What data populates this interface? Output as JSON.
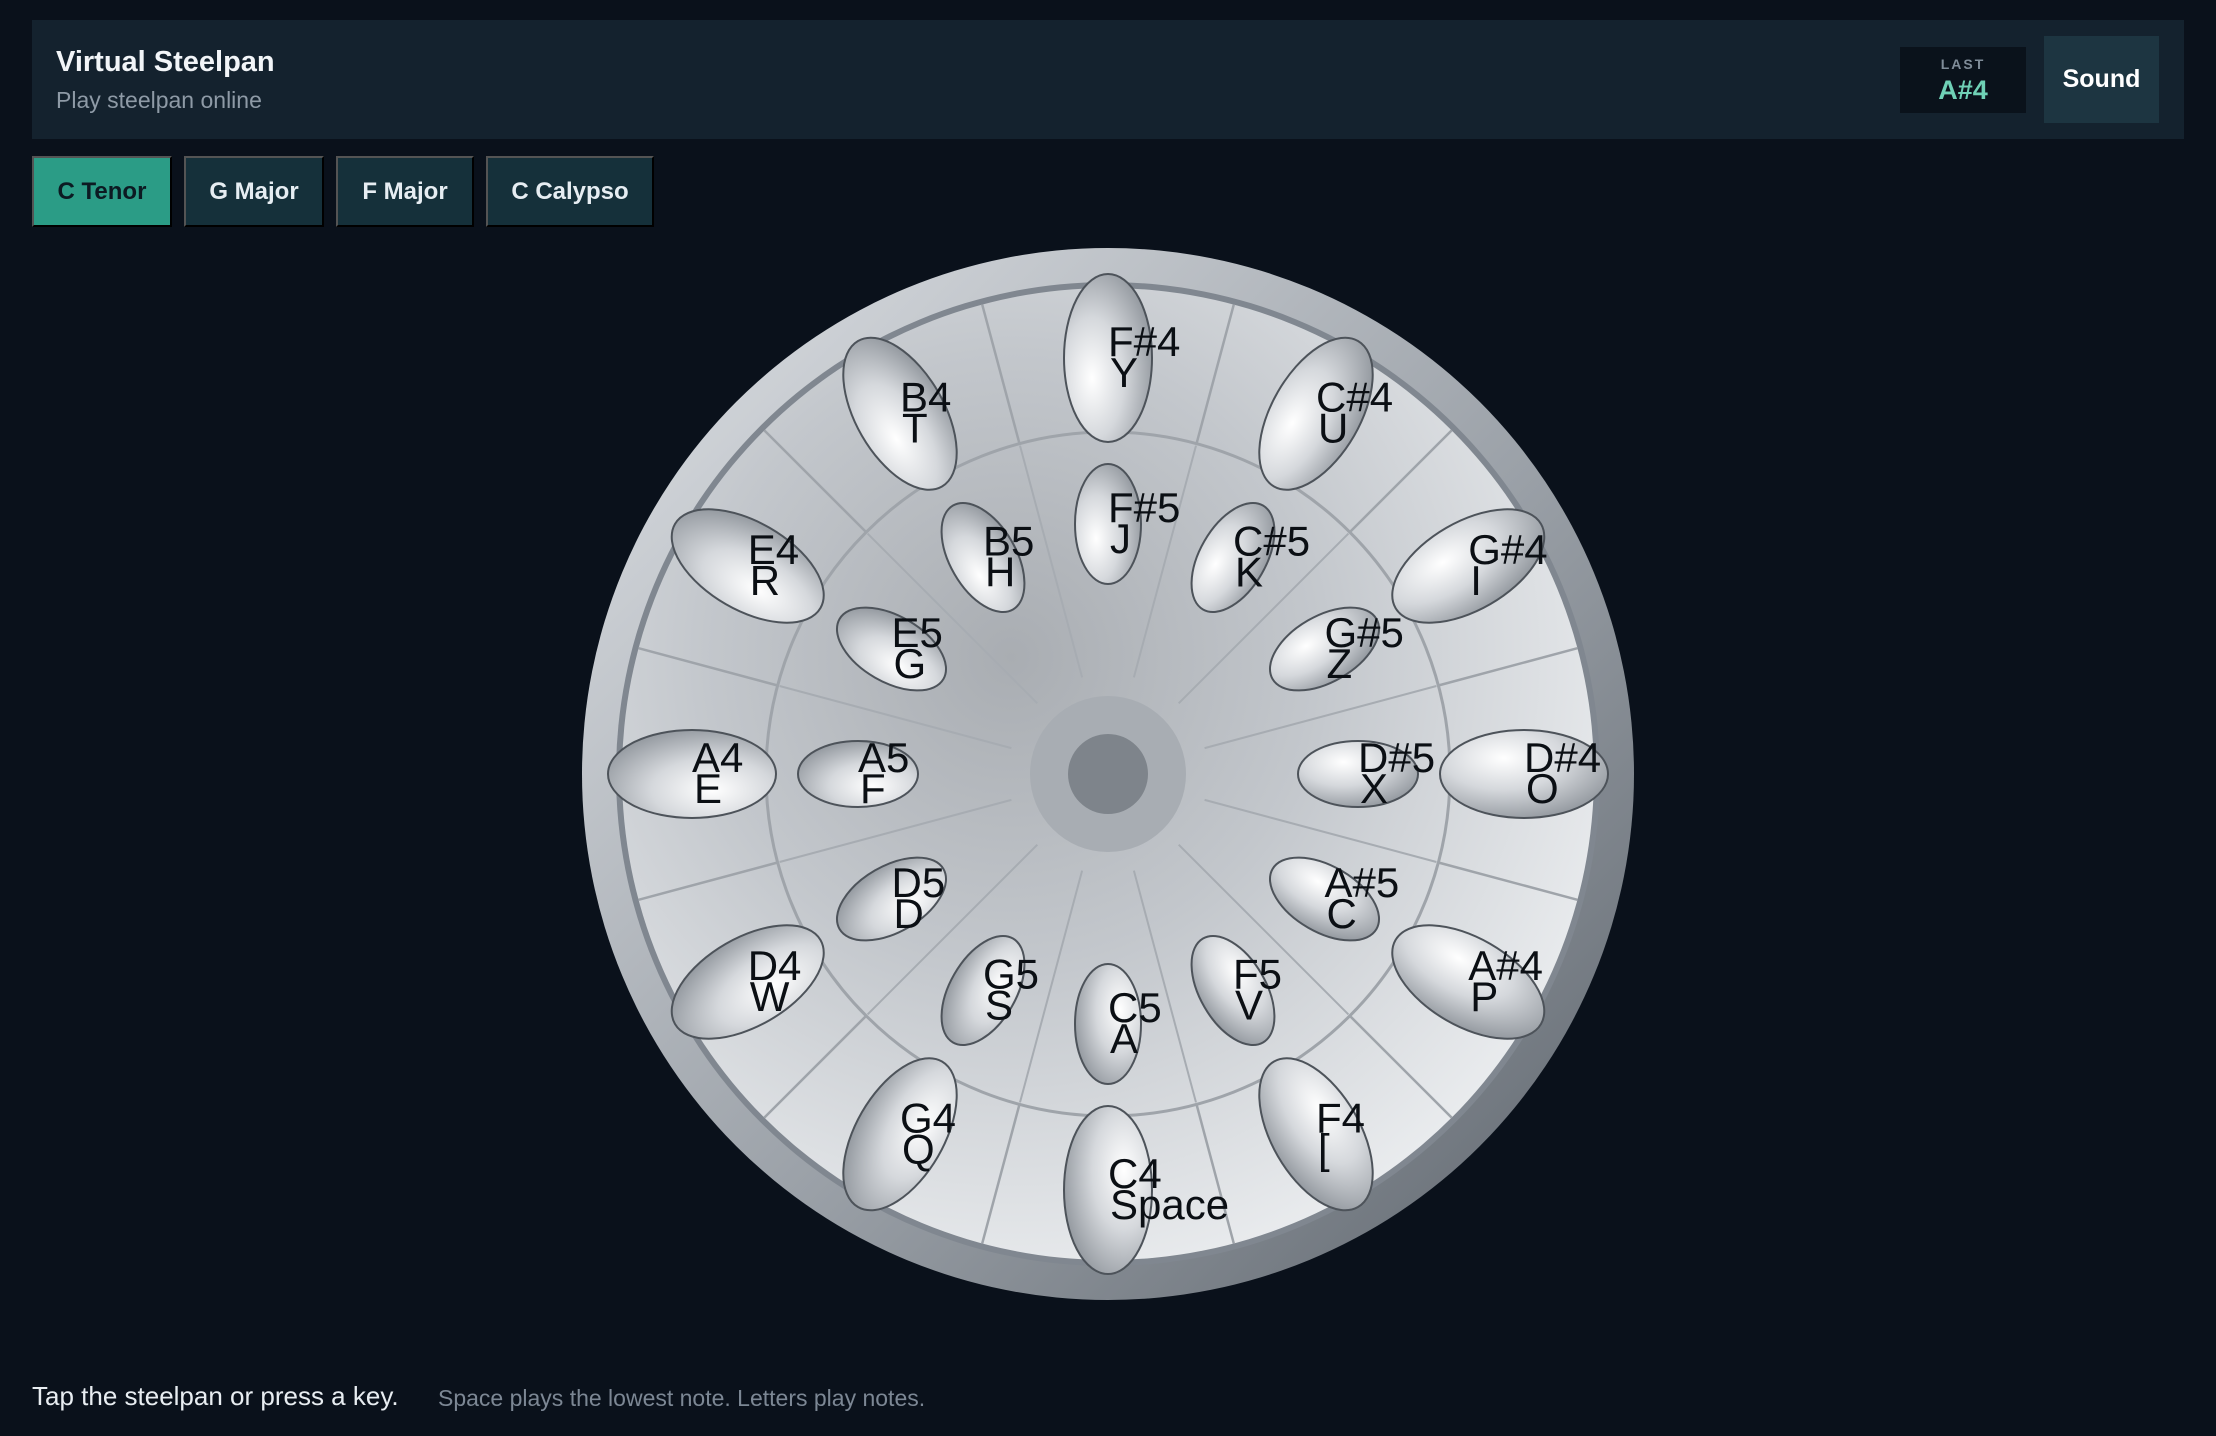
{
  "header": {
    "title": "Virtual Steelpan",
    "subtitle": "Play steelpan online",
    "last_label": "LAST",
    "last_value": "A#4",
    "sound_button": "Sound"
  },
  "scales": {
    "active": "C Tenor",
    "items": [
      "C Tenor",
      "G Major",
      "F Major",
      "C Calypso"
    ]
  },
  "pan": {
    "outer_ring": [
      {
        "note": "F#4",
        "key": "Y"
      },
      {
        "note": "C#4",
        "key": "U"
      },
      {
        "note": "G#4",
        "key": "I"
      },
      {
        "note": "D#4",
        "key": "O"
      },
      {
        "note": "A#4",
        "key": "P"
      },
      {
        "note": "F4",
        "key": "["
      },
      {
        "note": "C4",
        "key": "Space"
      },
      {
        "note": "G4",
        "key": "Q"
      },
      {
        "note": "D4",
        "key": "W"
      },
      {
        "note": "A4",
        "key": "E"
      },
      {
        "note": "E4",
        "key": "R"
      },
      {
        "note": "B4",
        "key": "T"
      }
    ],
    "inner_ring": [
      {
        "note": "F#5",
        "key": "J"
      },
      {
        "note": "C#5",
        "key": "K"
      },
      {
        "note": "G#5",
        "key": "Z"
      },
      {
        "note": "D#5",
        "key": "X"
      },
      {
        "note": "A#5",
        "key": "C"
      },
      {
        "note": "F5",
        "key": "V"
      },
      {
        "note": "C5",
        "key": "A"
      },
      {
        "note": "G5",
        "key": "S"
      },
      {
        "note": "D5",
        "key": "D"
      },
      {
        "note": "A5",
        "key": "F"
      },
      {
        "note": "E5",
        "key": "G"
      },
      {
        "note": "B5",
        "key": "H"
      }
    ]
  },
  "footer": {
    "instruction": "Tap the steelpan or press a key.",
    "hint": "Space plays the lowest note. Letters play notes."
  }
}
